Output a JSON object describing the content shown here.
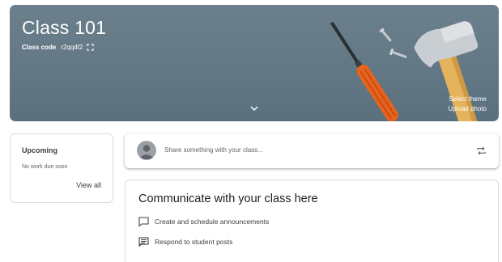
{
  "banner": {
    "title": "Class 101",
    "class_code_label": "Class code",
    "class_code_value": "r2qq4f2",
    "select_theme": "Select theme",
    "upload_photo": "Upload photo",
    "background_color": "#637885"
  },
  "upcoming": {
    "title": "Upcoming",
    "empty_message": "No work due soon",
    "view_all": "View all"
  },
  "stream": {
    "share_placeholder": "Share something with your class..."
  },
  "communicate": {
    "title": "Communicate with your class here",
    "items": [
      {
        "icon": "announcement-icon",
        "label": "Create and schedule announcements"
      },
      {
        "icon": "reply-posts-icon",
        "label": "Respond to student posts"
      }
    ]
  },
  "icons": {
    "fullscreen": "fullscreen-icon",
    "expand": "chevron-down-icon",
    "repost": "repost-icon",
    "avatar": "avatar"
  }
}
